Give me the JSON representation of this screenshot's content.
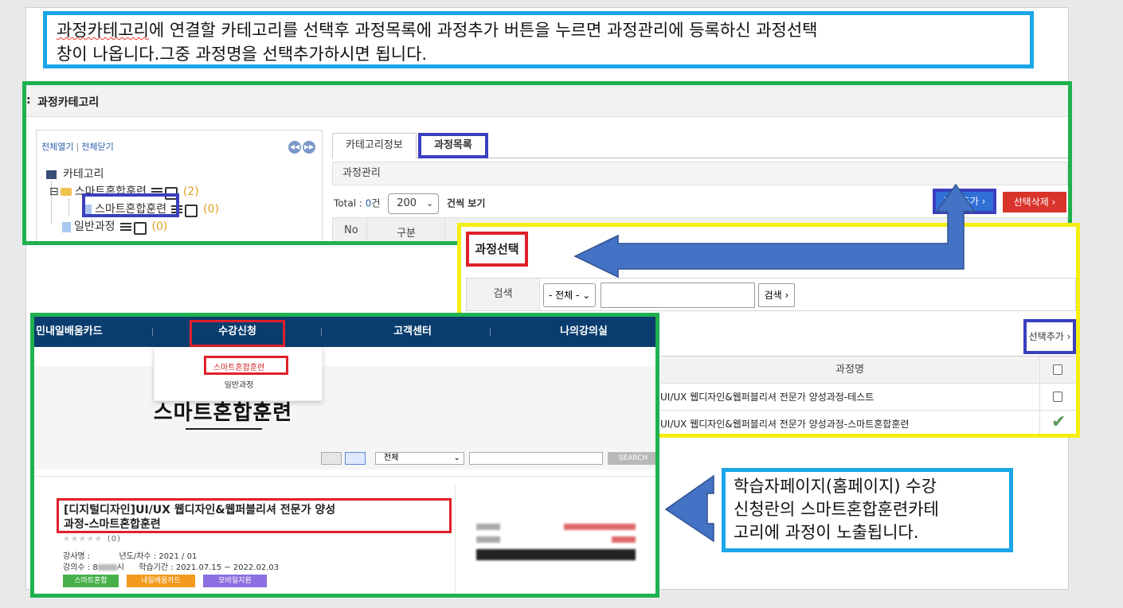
{
  "callout_top": {
    "line1_a": "과정카테고리",
    "line1_b": "에 연결할 카테고리를 선택후 과정목록에 과정추가 버튼을 누르면 과정관리에 등록하신 과정선택",
    "line2": "창이 나옵니다.그중 과정명을 선택추가하시면 됩니다."
  },
  "admin": {
    "title": "과정카테고리",
    "tree": {
      "expand_all": "전체열기",
      "separator": "|",
      "collapse_all": "전체닫기",
      "root": "카테고리",
      "node1": "스마트혼합훈련",
      "node1_count": "(2)",
      "node1_child": "스마트혼합훈련",
      "node1_child_count": "(0)",
      "node2": "일반과정",
      "node2_count": "(0)"
    },
    "tabs": [
      "카테고리정보",
      "과정목록"
    ],
    "sub_header": "과정관리",
    "total_label": "Total : ",
    "total_count": "0",
    "total_unit": "건",
    "per_page": "200",
    "per_page_suffix": "건씩 보기",
    "add_course_button": "과정추가 ›",
    "delete_button": "선택삭제 ›",
    "columns": [
      "No",
      "구분"
    ]
  },
  "popup": {
    "title": "과정선택",
    "search_label": "검색",
    "filter_value": "- 전체 -",
    "search_button": "검색 ›",
    "add_selected_button": "선택추가 ›",
    "column_name": "과정명",
    "rows": [
      {
        "name": "UI/UX 웹디자인&웹퍼블리셔 전문가 양성과정-테스트",
        "checked": false
      },
      {
        "name": "UI/UX 웹디자인&웹퍼블리셔 전문가 양성과정-스마트혼합훈련",
        "checked": true
      }
    ]
  },
  "site": {
    "nav": [
      "민내일배움카드",
      "수강신청",
      "고객센터",
      "나의강의실"
    ],
    "dropdown": [
      "스마트혼합훈련",
      "일반과정"
    ],
    "page_title": "스마트혼합훈련",
    "filter_value": "전체",
    "search_button": "SEARCH",
    "course_title_line1": "[디지털디자인]UI/UX 웹디자인&웹퍼블리셔 전문가 양성",
    "course_title_line2": "과정-스마트혼합훈련",
    "rating_count": "(0)",
    "instructor_label": "강사명 :",
    "year_label": "년도/차수 : 2021 / 01",
    "lessons_label": "강의수 : 8",
    "lessons_suffix": "시",
    "period_label": "학습기간 :",
    "period_start": "2021.07.15",
    "period_end": "2022.02.03",
    "tags": [
      "스마트혼합",
      "내일배움카드",
      "모바일지원"
    ],
    "tag_colors": [
      "#47b04b",
      "#f39a1c",
      "#8c6fe0"
    ]
  },
  "callout_br": {
    "line1": "학습자페이지(홈페이지) 수강",
    "line2": "신청란의 스마트혼합훈련카테",
    "line3": "고리에 과정이 노출됩니다."
  },
  "colors": {
    "callout_border": "#1aa6e8",
    "green_frame": "#1fb14f",
    "yellow_frame": "#f5ee14",
    "red_highlight": "#e0202a",
    "blue_highlight": "#3a3fbf",
    "arrow": "#4472c4",
    "nav_bg": "#0a3d6e"
  }
}
